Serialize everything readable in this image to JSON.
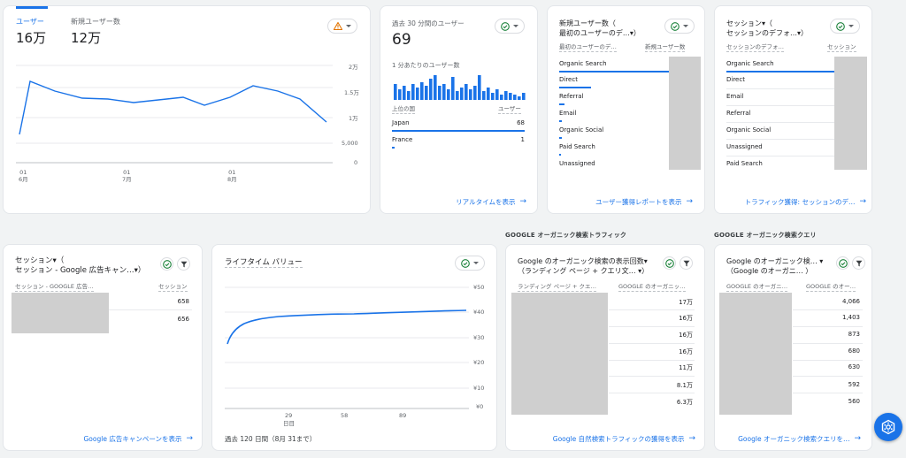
{
  "card1": {
    "metric1_label": "ユーザー",
    "metric1_value": "16万",
    "metric2_label": "新規ユーザー数",
    "metric2_value": "12万",
    "y_ticks": [
      "2万",
      "1.5万",
      "1万",
      "5,000",
      "0"
    ],
    "x_ticks": [
      {
        "d": "01",
        "m": "6月"
      },
      {
        "d": "01",
        "m": "7月"
      },
      {
        "d": "01",
        "m": "8月"
      }
    ]
  },
  "card2": {
    "title": "過去 30 分間のユーザー",
    "value": "69",
    "subtitle": "1 分あたりのユーザー数",
    "col_country": "上位の国",
    "col_users": "ユーザー",
    "rows": [
      {
        "name": "Japan",
        "value": "68"
      },
      {
        "name": "France",
        "value": "1"
      }
    ],
    "link": "リアルタイムを表示"
  },
  "card3": {
    "title_line1": "新規ユーザー数（",
    "title_line2": "最初のユーザーのデ…▾）",
    "col1": "最初のユーザーのデ…",
    "col2": "新規ユーザー数",
    "rows": [
      "Organic Search",
      "Direct",
      "Referral",
      "Email",
      "Organic Social",
      "Paid Search",
      "Unassigned"
    ],
    "link": "ユーザー獲得レポートを表示"
  },
  "card4": {
    "title_line1": "セッション▾（",
    "title_line2": "セッションのデフォ…▾）",
    "col1": "セッションのデフォ…",
    "col2": "セッション",
    "rows": [
      "Organic Search",
      "Direct",
      "Email",
      "Referral",
      "Organic Social",
      "Unassigned",
      "Paid Search"
    ],
    "link": "トラフィック獲得: セッションのデ…"
  },
  "card5": {
    "title_line1": "セッション▾（",
    "title_line2": "セッション - Google 広告キャン…▾）",
    "col1": "セッション - GOOGLE 広告…",
    "col2": "セッション",
    "values": [
      "658",
      "656"
    ],
    "link": "Google 広告キャンペーンを表示"
  },
  "card6": {
    "title": "ライフタイム バリュー",
    "y_ticks": [
      "¥50",
      "¥40",
      "¥30",
      "¥20",
      "¥10",
      "¥0"
    ],
    "x_ticks": [
      "29",
      "58",
      "89"
    ],
    "x_sub": "日目",
    "footer": "過去 120 日間（8月 31まで）"
  },
  "card7": {
    "section": "GOOGLE オーガニック検索トラフィック",
    "title_line1": "Google のオーガニック検索の表示回数▾",
    "title_line2": "（ランディング ページ + クエリ文… ▾）",
    "col1": "ランディング ページ + クエ…",
    "col2": "GOOGLE のオーガニッ…",
    "values": [
      "17万",
      "16万",
      "16万",
      "16万",
      "11万",
      "8.1万",
      "6.3万"
    ],
    "link": "Google 自然検索トラフィックの獲得を表示"
  },
  "card8": {
    "section": "GOOGLE オーガニック検索クエリ",
    "title_line1": "Google のオーガニック検… ▾",
    "title_line2": "（Google のオーガニ… ）",
    "col1": "GOOGLE のオーガニ…",
    "col2": "GOOGLE のオー…",
    "values": [
      "4,066",
      "1,403",
      "873",
      "680",
      "630",
      "592",
      "560"
    ],
    "link": "Google オーガニック検索クエリを…"
  },
  "colors": {
    "accent": "#1a73e8",
    "warning": "#e37400",
    "ok": "#188038"
  }
}
